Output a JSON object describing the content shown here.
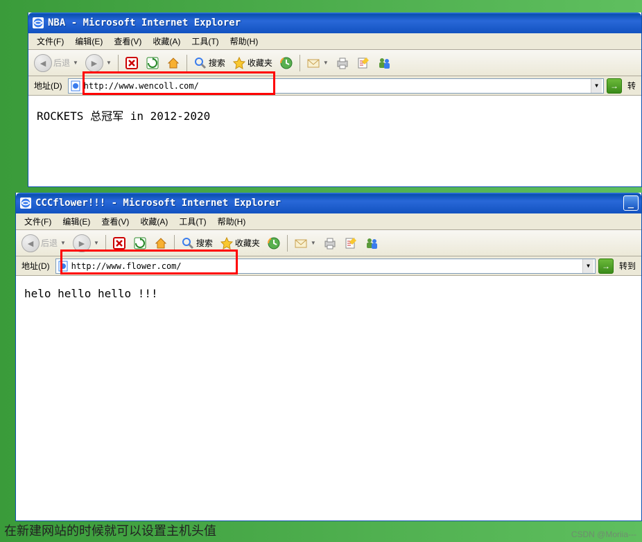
{
  "windows": [
    {
      "title": "NBA - Microsoft Internet Explorer",
      "menu": [
        "文件(F)",
        "编辑(E)",
        "查看(V)",
        "收藏(A)",
        "工具(T)",
        "帮助(H)"
      ],
      "toolbar": {
        "back_label": "后退",
        "search_label": "搜索",
        "favorites_label": "收藏夹"
      },
      "addr": {
        "label": "地址(D)",
        "url": "http://www.wencoll.com/",
        "go_label": "转"
      },
      "content": "ROCKETS 总冠军 in 2012-2020"
    },
    {
      "title": "CCCflower!!! - Microsoft Internet Explorer",
      "menu": [
        "文件(F)",
        "编辑(E)",
        "查看(V)",
        "收藏(A)",
        "工具(T)",
        "帮助(H)"
      ],
      "toolbar": {
        "back_label": "后退",
        "search_label": "搜索",
        "favorites_label": "收藏夹"
      },
      "addr": {
        "label": "地址(D)",
        "url": "http://www.flower.com/",
        "go_label": "转到"
      },
      "content": "helo hello hello !!!"
    }
  ],
  "caption": "在新建网站的时候就可以设置主机头值",
  "watermark": "CSDN @Moriia---"
}
